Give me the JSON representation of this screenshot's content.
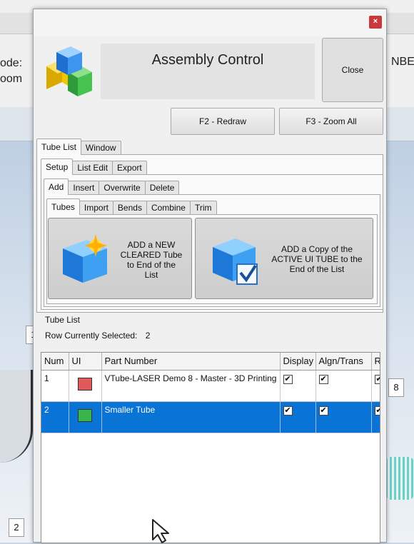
{
  "background": {
    "left_text_line1": "ode:",
    "left_text_line2": "oom",
    "right_text": "NBE",
    "labels": [
      "1",
      "8",
      "2"
    ]
  },
  "dialog": {
    "close_x": "×",
    "title": "Assembly Control",
    "close_label": "Close",
    "redraw_label": "F2 - Redraw",
    "zoom_all_label": "F3 - Zoom All",
    "main_tabs": [
      "Tube List",
      "Window"
    ],
    "sub_tabs": [
      "Setup",
      "List Edit",
      "Export"
    ],
    "action_tabs": [
      "Add",
      "Insert",
      "Overwrite",
      "Delete"
    ],
    "add_tabs": [
      "Tubes",
      "Import",
      "Bends",
      "Combine",
      "Trim"
    ],
    "add_new_lines": [
      "ADD a NEW",
      "CLEARED Tube",
      "to End of the",
      "List"
    ],
    "add_copy_lines": [
      "ADD a Copy of the",
      "ACTIVE UI TUBE to the",
      "End of the List"
    ],
    "tube_list_label": "Tube List",
    "row_selected_label": "Row Currently Selected:",
    "row_selected_value": "2"
  },
  "table": {
    "columns": [
      "Num",
      "UI",
      "Part Number",
      "Display",
      "Algn/Trans",
      "R"
    ],
    "rows": [
      {
        "num": "1",
        "color": "#e05a5a",
        "part": "VTube-LASER Demo 8 - Master - 3D Printing",
        "display": "✔",
        "algn": "✔",
        "r": "✔",
        "selected": false
      },
      {
        "num": "2",
        "color": "#39b54a",
        "part": "Smaller Tube",
        "display": "✔",
        "algn": "✔",
        "r": "✔",
        "selected": true
      }
    ]
  },
  "colors": {
    "selection": "#0a74d6",
    "close_x_bg": "#c8393b"
  }
}
